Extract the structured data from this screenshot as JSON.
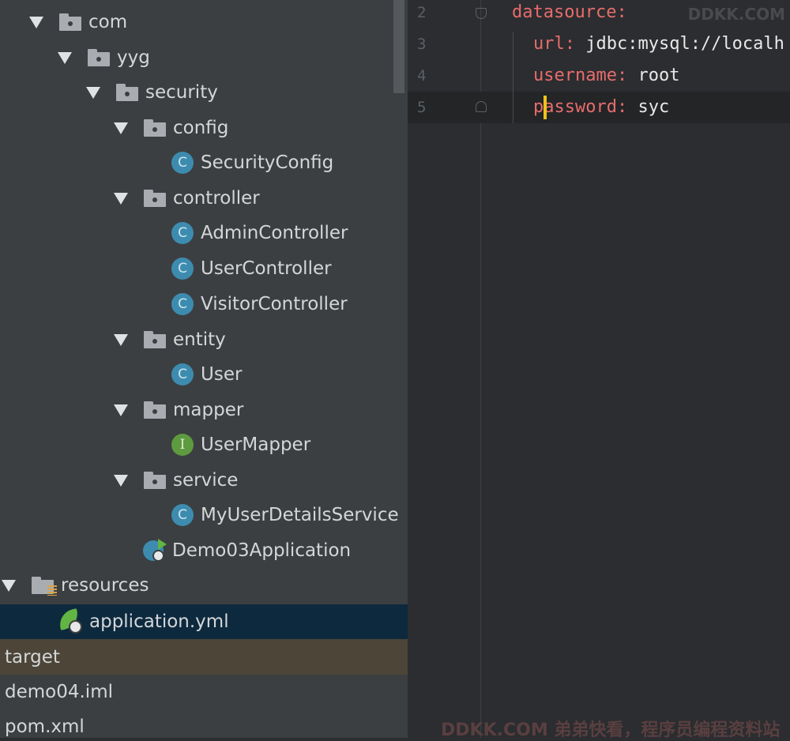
{
  "project_tree": {
    "items": [
      {
        "label": "com",
        "kind": "folder",
        "expanded": true
      },
      {
        "label": "yyg",
        "kind": "folder",
        "expanded": true
      },
      {
        "label": "security",
        "kind": "folder",
        "expanded": true
      },
      {
        "label": "config",
        "kind": "folder",
        "expanded": true
      },
      {
        "label": "SecurityConfig",
        "kind": "class",
        "icon_letter": "C"
      },
      {
        "label": "controller",
        "kind": "folder",
        "expanded": true
      },
      {
        "label": "AdminController",
        "kind": "class",
        "icon_letter": "C"
      },
      {
        "label": "UserController",
        "kind": "class",
        "icon_letter": "C"
      },
      {
        "label": "VisitorController",
        "kind": "class",
        "icon_letter": "C"
      },
      {
        "label": "entity",
        "kind": "folder",
        "expanded": true
      },
      {
        "label": "User",
        "kind": "class",
        "icon_letter": "C"
      },
      {
        "label": "mapper",
        "kind": "folder",
        "expanded": true
      },
      {
        "label": "UserMapper",
        "kind": "interface",
        "icon_letter": "I"
      },
      {
        "label": "service",
        "kind": "folder",
        "expanded": true
      },
      {
        "label": "MyUserDetailsService",
        "kind": "class",
        "icon_letter": "C"
      },
      {
        "label": "Demo03Application",
        "kind": "spring-app"
      },
      {
        "label": "resources",
        "kind": "resources-folder",
        "expanded": true
      },
      {
        "label": "application.yml",
        "kind": "yml",
        "selected": true
      },
      {
        "label": "target",
        "kind": "excluded"
      },
      {
        "label": "demo04.iml",
        "kind": "file"
      },
      {
        "label": "pom.xml",
        "kind": "file"
      }
    ]
  },
  "editor": {
    "lines": [
      {
        "number": "2",
        "key": "datasource",
        "sep": ":",
        "value": ""
      },
      {
        "number": "3",
        "key": "url",
        "sep": ":",
        "value": " jdbc:mysql://localh"
      },
      {
        "number": "4",
        "key": "username",
        "sep": ":",
        "value": " root"
      },
      {
        "number": "5",
        "key": "password",
        "sep": ":",
        "value": " syc",
        "current": true
      }
    ]
  },
  "watermarks": {
    "top": "DDKK.COM",
    "bottom": "DDKK.COM 弟弟快看，程序员编程资料站"
  },
  "colors": {
    "tree_bg": "#3c3f41",
    "selected_row": "#0d293e",
    "target_row": "#4c4538",
    "editor_bg": "#2b2d30",
    "yaml_key": "#e86c6c",
    "caret": "#f0c419",
    "class_icon": "#3d8cb0",
    "interface_icon": "#5e9a3f"
  }
}
